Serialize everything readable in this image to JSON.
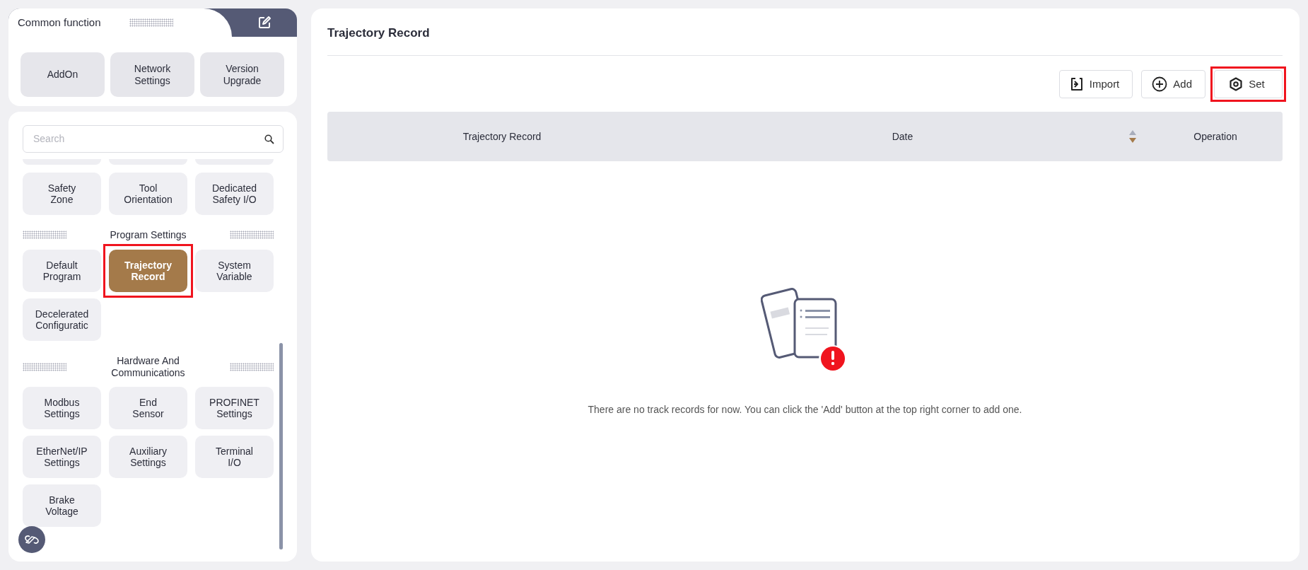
{
  "sidebar": {
    "common_function": {
      "title": "Common function",
      "shortcuts": [
        {
          "label": "AddOn"
        },
        {
          "label": "Network\nSettings"
        },
        {
          "label": "Version\nUpgrade"
        }
      ]
    },
    "search": {
      "placeholder": "Search"
    },
    "sections": [
      {
        "items": [
          {
            "label": "Safety\nZone",
            "selected": false,
            "highlighted": false
          },
          {
            "label": "Tool\nOrientation",
            "selected": false,
            "highlighted": false
          },
          {
            "label": "Dedicated\nSafety I/O",
            "selected": false,
            "highlighted": false
          }
        ]
      },
      {
        "title": "Program Settings",
        "items": [
          {
            "label": "Default\nProgram",
            "selected": false,
            "highlighted": false
          },
          {
            "label": "Trajectory\nRecord",
            "selected": true,
            "highlighted": true
          },
          {
            "label": "System\nVariable",
            "selected": false,
            "highlighted": false
          },
          {
            "label": "Decelerated\nConfiguratic",
            "selected": false,
            "highlighted": false
          }
        ]
      },
      {
        "title": "Hardware And\nCommunications",
        "items": [
          {
            "label": "Modbus\nSettings",
            "selected": false,
            "highlighted": false
          },
          {
            "label": "End\nSensor",
            "selected": false,
            "highlighted": false
          },
          {
            "label": "PROFINET\nSettings",
            "selected": false,
            "highlighted": false
          },
          {
            "label": "EtherNet/IP\nSettings",
            "selected": false,
            "highlighted": false
          },
          {
            "label": "Auxiliary\nSettings",
            "selected": false,
            "highlighted": false
          },
          {
            "label": "Terminal\nI/O",
            "selected": false,
            "highlighted": false
          },
          {
            "label": "Brake\nVoltage",
            "selected": false,
            "highlighted": false
          }
        ]
      }
    ]
  },
  "main": {
    "title": "Trajectory Record",
    "toolbar": [
      {
        "label": "Import",
        "kind": "import",
        "highlighted": false
      },
      {
        "label": "Add",
        "kind": "add",
        "highlighted": false
      },
      {
        "label": "Set",
        "kind": "settings",
        "highlighted": true
      }
    ],
    "table": {
      "columns": [
        {
          "label": "Trajectory Record",
          "sortable": false
        },
        {
          "label": "Date",
          "sortable": true,
          "descending": true
        },
        {
          "label": "Operation",
          "sortable": false
        }
      ]
    },
    "empty_message": "There are no track records for now. You can click the 'Add' button at the top right corner to add one."
  }
}
